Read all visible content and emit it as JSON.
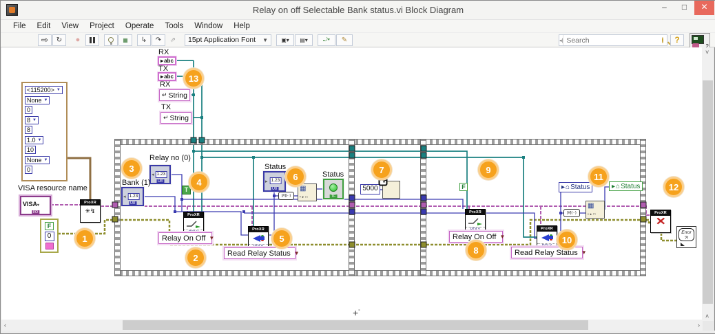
{
  "window": {
    "title": "Relay on off Selectable Bank status.vi Block Diagram"
  },
  "menu": {
    "items": [
      "File",
      "Edit",
      "View",
      "Project",
      "Operate",
      "Tools",
      "Window",
      "Help"
    ]
  },
  "toolbar": {
    "font_selector": "15pt Application Font",
    "search_placeholder": "Search",
    "vi_badge": "2"
  },
  "diagram": {
    "badges": [
      "1",
      "2",
      "3",
      "4",
      "5",
      "6",
      "7",
      "8",
      "9",
      "10",
      "11",
      "12",
      "13"
    ],
    "terminals": {
      "rx": "RX",
      "tx": "TX",
      "abc": "abc",
      "string": "String"
    },
    "serial_cluster": [
      "<115200>",
      "None",
      "0",
      "8",
      "8",
      "1.0",
      "10",
      "None",
      "0"
    ],
    "visa": {
      "label": "VISA resource name",
      "text": "VISA",
      "tag": "I/O"
    },
    "error_cluster": {
      "status": "F",
      "code": "0"
    },
    "node": {
      "header": "ProXR",
      "poly": "POLY"
    },
    "controls": {
      "relay_no": "Relay no (0)",
      "bank": "Bank (1)",
      "numeric": "1.23",
      "type_u8": "U8",
      "status": "Status",
      "type_tf": "TF",
      "true": "T",
      "false": "F",
      "wait_ms": "5000"
    },
    "selectors": {
      "relay": "Relay On Off",
      "read": "Read Relay Status"
    },
    "local_status": "Status",
    "error_handler": {
      "line1": "Error",
      "line2": "?!"
    }
  }
}
